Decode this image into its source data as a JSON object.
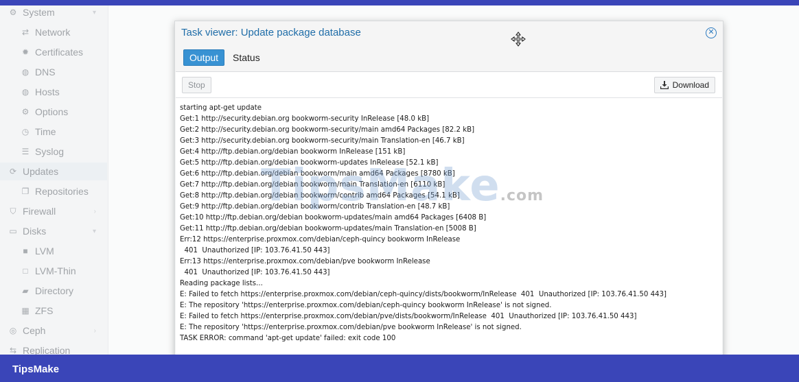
{
  "sidebar": {
    "items": [
      {
        "label": "System",
        "icon": "gear-icon",
        "level": 1
      },
      {
        "label": "Network",
        "icon": "arrows-icon",
        "level": 2
      },
      {
        "label": "Certificates",
        "icon": "certificate-icon",
        "level": 2
      },
      {
        "label": "DNS",
        "icon": "globe-icon",
        "level": 2
      },
      {
        "label": "Hosts",
        "icon": "globe-icon",
        "level": 2
      },
      {
        "label": "Options",
        "icon": "gear-icon",
        "level": 2
      },
      {
        "label": "Time",
        "icon": "clock-icon",
        "level": 2
      },
      {
        "label": "Syslog",
        "icon": "list-icon",
        "level": 2
      },
      {
        "label": "Updates",
        "icon": "refresh-icon",
        "level": 1
      },
      {
        "label": "Repositories",
        "icon": "files-icon",
        "level": 2
      },
      {
        "label": "Firewall",
        "icon": "shield-icon",
        "level": 1
      },
      {
        "label": "Disks",
        "icon": "hdd-icon",
        "level": 1
      },
      {
        "label": "LVM",
        "icon": "square-icon",
        "level": 2
      },
      {
        "label": "LVM-Thin",
        "icon": "square-outline-icon",
        "level": 2
      },
      {
        "label": "Directory",
        "icon": "folder-icon",
        "level": 2
      },
      {
        "label": "ZFS",
        "icon": "grid-icon",
        "level": 2
      },
      {
        "label": "Ceph",
        "icon": "ceph-icon",
        "level": 1
      },
      {
        "label": "Replication",
        "icon": "retweet-icon",
        "level": 1
      }
    ]
  },
  "dialog": {
    "title": "Task viewer: Update package database",
    "tabs": [
      {
        "label": "Output",
        "active": true
      },
      {
        "label": "Status",
        "active": false
      }
    ],
    "toolbar": {
      "stop_label": "Stop",
      "download_label": "Download"
    },
    "log": [
      "starting apt-get update",
      "Get:1 http://security.debian.org bookworm-security InRelease [48.0 kB]",
      "Get:2 http://security.debian.org bookworm-security/main amd64 Packages [82.2 kB]",
      "Get:3 http://security.debian.org bookworm-security/main Translation-en [46.7 kB]",
      "Get:4 http://ftp.debian.org/debian bookworm InRelease [151 kB]",
      "Get:5 http://ftp.debian.org/debian bookworm-updates InRelease [52.1 kB]",
      "Get:6 http://ftp.debian.org/debian bookworm/main amd64 Packages [8780 kB]",
      "Get:7 http://ftp.debian.org/debian bookworm/main Translation-en [6110 kB]",
      "Get:8 http://ftp.debian.org/debian bookworm/contrib amd64 Packages [54.1 kB]",
      "Get:9 http://ftp.debian.org/debian bookworm/contrib Translation-en [48.7 kB]",
      "Get:10 http://ftp.debian.org/debian bookworm-updates/main amd64 Packages [6408 B]",
      "Get:11 http://ftp.debian.org/debian bookworm-updates/main Translation-en [5008 B]",
      "Err:12 https://enterprise.proxmox.com/debian/ceph-quincy bookworm InRelease",
      "  401  Unauthorized [IP: 103.76.41.50 443]",
      "Err:13 https://enterprise.proxmox.com/debian/pve bookworm InRelease",
      "  401  Unauthorized [IP: 103.76.41.50 443]",
      "Reading package lists...",
      "E: Failed to fetch https://enterprise.proxmox.com/debian/ceph-quincy/dists/bookworm/InRelease  401  Unauthorized [IP: 103.76.41.50 443]",
      "E: The repository 'https://enterprise.proxmox.com/debian/ceph-quincy bookworm InRelease' is not signed.",
      "E: Failed to fetch https://enterprise.proxmox.com/debian/pve/dists/bookworm/InRelease  401  Unauthorized [IP: 103.76.41.50 443]",
      "E: The repository 'https://enterprise.proxmox.com/debian/pve bookworm InRelease' is not signed.",
      "TASK ERROR: command 'apt-get update' failed: exit code 100"
    ]
  },
  "watermark": {
    "text": "TipsMake",
    "suffix": ".com"
  },
  "footer": {
    "brand": "TipsMake"
  },
  "colors": {
    "accent": "#3892d3",
    "title": "#1f6da8",
    "frame": "#3a45b8"
  }
}
